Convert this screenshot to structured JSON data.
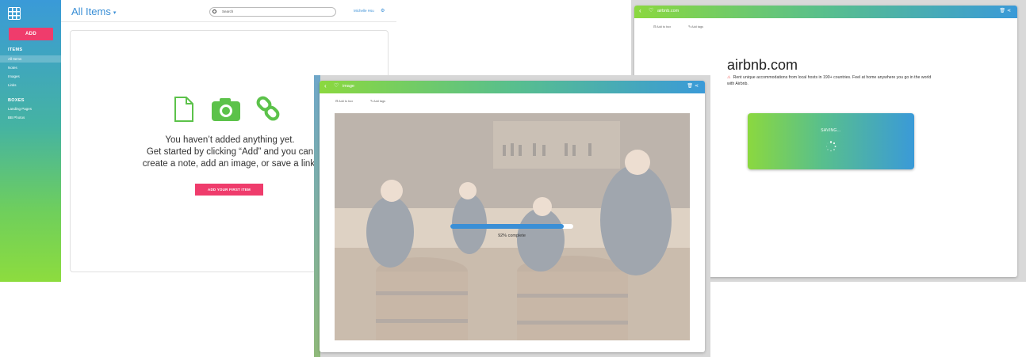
{
  "app": {
    "add_label": "ADD",
    "sections": [
      {
        "heading": "ITEMS",
        "items": [
          "All Items",
          "Notes",
          "Images",
          "Links"
        ]
      },
      {
        "heading": "BOXES",
        "items": [
          "Landing Pages",
          "BB Photos"
        ]
      }
    ],
    "title": "All Items",
    "search_placeholder": "Search",
    "user_name": "Michelle Hsu",
    "empty_message_lines": [
      "You haven’t added anything yet.",
      "Get started by clicking “Add” and you can",
      "create a note, add an image, or save a link."
    ],
    "first_item_label": "ADD YOUR FIRST ITEM",
    "colors": {
      "accent": "#ef3c6c",
      "title": "#3a8fd6"
    }
  },
  "image_window": {
    "title": "image",
    "add_to_box": "Add to box",
    "add_tags": "Add tags",
    "progress_percent": 92,
    "progress_text": "92% complete"
  },
  "airbnb_window": {
    "title": "airbnb.com",
    "add_to_box": "Add to box",
    "add_tags": "Add tags",
    "page_title": "airbnb.com",
    "description": "Rent unique accommodations from local hosts in 190+ countries. Feel at home anywhere you go in the world with Airbnb.",
    "saving_label": "SAVING..."
  }
}
